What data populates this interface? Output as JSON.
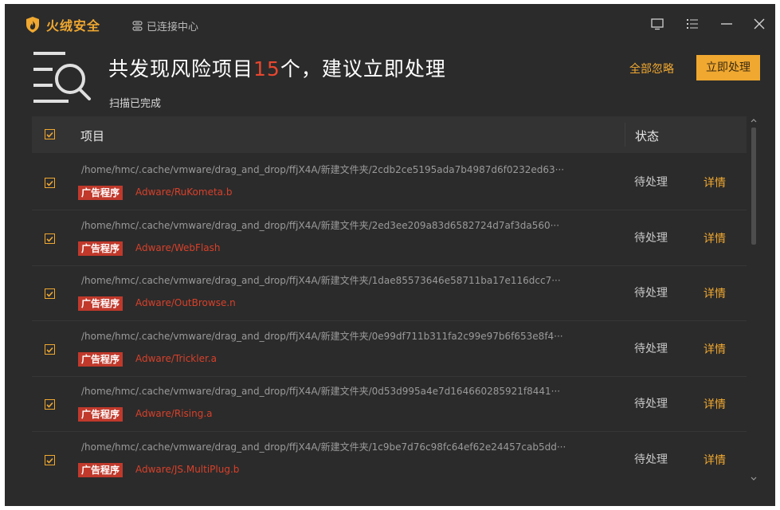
{
  "app": {
    "name": "火绒安全",
    "connection_label": "已连接中心"
  },
  "header": {
    "title_prefix": "共发现风险项目",
    "risk_count": "15",
    "title_suffix": "个，建议立即处理",
    "subtitle": "扫描已完成",
    "ignore_all_label": "全部忽略",
    "fix_now_label": "立即处理"
  },
  "table": {
    "col_item": "项目",
    "col_status": "状态",
    "rows": [
      {
        "path": "/home/hmc/.cache/vmware/drag_and_drop/ffjX4A/新建文件夹/2cdb2ce5195ada7b4987d6f0232ed63···",
        "category": "广告程序",
        "threat": "Adware/RuKometa.b",
        "status": "待处理",
        "action": "详情"
      },
      {
        "path": "/home/hmc/.cache/vmware/drag_and_drop/ffjX4A/新建文件夹/2ed3ee209a83d6582724d7af3da560···",
        "category": "广告程序",
        "threat": "Adware/WebFlash",
        "status": "待处理",
        "action": "详情"
      },
      {
        "path": "/home/hmc/.cache/vmware/drag_and_drop/ffjX4A/新建文件夹/1dae85573646e58711ba17e116dcc7···",
        "category": "广告程序",
        "threat": "Adware/OutBrowse.n",
        "status": "待处理",
        "action": "详情"
      },
      {
        "path": "/home/hmc/.cache/vmware/drag_and_drop/ffjX4A/新建文件夹/0e99df711b311fa2c99e97b6f653e8f4···",
        "category": "广告程序",
        "threat": "Adware/Trickler.a",
        "status": "待处理",
        "action": "详情"
      },
      {
        "path": "/home/hmc/.cache/vmware/drag_and_drop/ffjX4A/新建文件夹/0d53d995a4e7d164660285921f8441···",
        "category": "广告程序",
        "threat": "Adware/Rising.a",
        "status": "待处理",
        "action": "详情"
      },
      {
        "path": "/home/hmc/.cache/vmware/drag_and_drop/ffjX4A/新建文件夹/1c9be7d76c98fc64ef62e24457cab5dd···",
        "category": "广告程序",
        "threat": "Adware/JS.MultiPlug.b",
        "status": "待处理",
        "action": "详情"
      }
    ]
  },
  "colors": {
    "accent": "#f0a830",
    "danger": "#e8472f",
    "background": "#2b2b2b"
  },
  "icons": [
    "shield-flame-icon",
    "link-icon",
    "monitor-icon",
    "menu-icon",
    "minimize-icon",
    "close-icon",
    "scan-list-icon",
    "checkbox-checked-icon"
  ]
}
